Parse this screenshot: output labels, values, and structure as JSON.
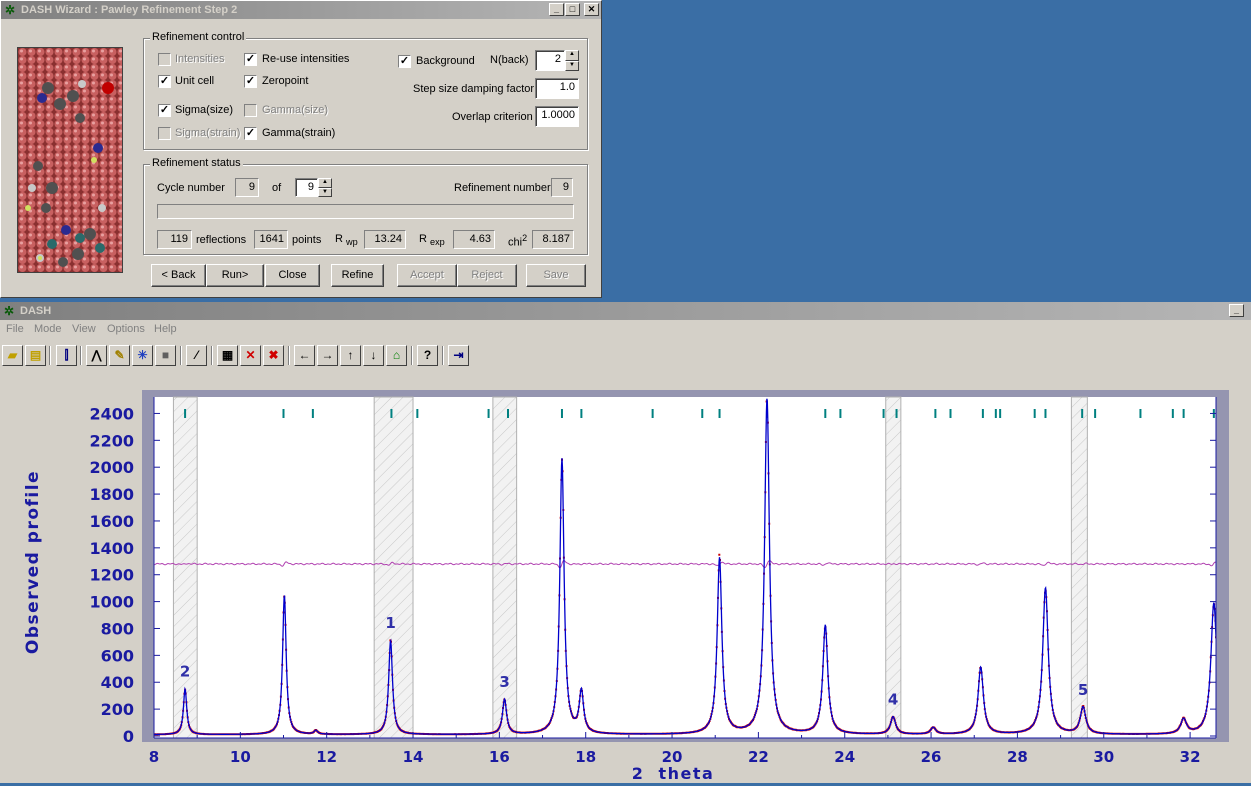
{
  "wizard": {
    "title": "DASH Wizard : Pawley Refinement Step 2",
    "refinement_control": {
      "legend": "Refinement control",
      "intensities": {
        "label": "Intensities",
        "checked": false,
        "enabled": false
      },
      "reuse_intensities": {
        "label": "Re-use intensities",
        "checked": true,
        "enabled": true
      },
      "unit_cell": {
        "label": "Unit cell",
        "checked": true,
        "enabled": true
      },
      "zeropoint": {
        "label": "Zeropoint",
        "checked": true,
        "enabled": true
      },
      "sigma_size": {
        "label": "Sigma(size)",
        "checked": true,
        "enabled": true
      },
      "gamma_size": {
        "label": "Gamma(size)",
        "checked": false,
        "enabled": false
      },
      "sigma_strain": {
        "label": "Sigma(strain)",
        "checked": false,
        "enabled": false
      },
      "gamma_strain": {
        "label": "Gamma(strain)",
        "checked": true,
        "enabled": true
      },
      "background": {
        "label": "Background",
        "checked": true
      },
      "nback_label": "N(back)",
      "nback_value": "2",
      "damping_label": "Step size damping factor",
      "damping_value": "1.0",
      "overlap_label": "Overlap criterion",
      "overlap_value": "1.0000"
    },
    "refinement_status": {
      "legend": "Refinement status",
      "cycle_label": "Cycle number",
      "cycle_value": "9",
      "of_label": "of",
      "of_value": "9",
      "refnum_label": "Refinement number",
      "refnum_value": "9",
      "reflections_value": "119",
      "reflections_label": "reflections",
      "points_value": "1641",
      "points_label": "points",
      "rwp_main": "R",
      "rwp_sub": "wp",
      "rwp_value": "13.24",
      "rexp_main": "R",
      "rexp_sub": "exp",
      "rexp_value": "4.63",
      "chi_main": "chi",
      "chi_sup": "2",
      "chi_value": "8.187"
    },
    "buttons": {
      "back": "< Back",
      "run": "Run>",
      "close": "Close",
      "refine": "Refine",
      "accept": "Accept",
      "reject": "Reject",
      "save": "Save"
    }
  },
  "main": {
    "title": "DASH",
    "menu": [
      "File",
      "Mode",
      "View",
      "Options",
      "Help"
    ],
    "toolbar_icons": [
      "open-folder-icon",
      "open-file-icon",
      "profile-view-icon",
      "peak-fit-icon",
      "pointer-tool-icon",
      "sun-tool-icon",
      "stop-icon",
      "wand-icon",
      "grid-icon",
      "delete-peaks-icon",
      "clear-peaks-icon",
      "arrow-left-icon",
      "arrow-right-icon",
      "arrow-up-icon",
      "arrow-down-icon",
      "home-icon",
      "help-icon",
      "exit-icon"
    ]
  },
  "chart_data": {
    "type": "line",
    "xlabel": "2  theta",
    "ylabel": "Observed  profile",
    "xlim": [
      8,
      32.6
    ],
    "ylim": [
      0,
      2500
    ],
    "xticks": [
      "8",
      "10",
      "12",
      "14",
      "16",
      "18",
      "20",
      "22",
      "24",
      "26",
      "28",
      "30",
      "32"
    ],
    "yticks": [
      "0",
      "200",
      "400",
      "600",
      "800",
      "1000",
      "1200",
      "1400",
      "1600",
      "1800",
      "2000",
      "2200",
      "2400"
    ],
    "colors": {
      "observed": "#cc0000",
      "calculated": "#0000cc",
      "difference": "#b040b0",
      "tickmarks": "#008080",
      "axis": "#1a1aa0"
    },
    "peaks": [
      {
        "x": 8.72,
        "h": 340
      },
      {
        "x": 11.02,
        "h": 1040
      },
      {
        "x": 11.75,
        "h": 28
      },
      {
        "x": 13.48,
        "h": 700
      },
      {
        "x": 16.12,
        "h": 260
      },
      {
        "x": 17.45,
        "h": 2050
      },
      {
        "x": 17.9,
        "h": 310
      },
      {
        "x": 21.1,
        "h": 1310
      },
      {
        "x": 22.2,
        "h": 2500
      },
      {
        "x": 23.55,
        "h": 810
      },
      {
        "x": 25.12,
        "h": 130
      },
      {
        "x": 26.05,
        "h": 50
      },
      {
        "x": 27.15,
        "h": 500
      },
      {
        "x": 28.65,
        "h": 1090
      },
      {
        "x": 29.52,
        "h": 200
      },
      {
        "x": 31.85,
        "h": 110
      },
      {
        "x": 32.55,
        "h": 980
      }
    ],
    "excluded_regions": [
      [
        8.45,
        9.0
      ],
      [
        13.1,
        14.0
      ],
      [
        15.85,
        16.4
      ],
      [
        24.95,
        25.3
      ],
      [
        29.25,
        29.62
      ]
    ],
    "region_labels": [
      {
        "text": "2",
        "x": 8.72
      },
      {
        "text": "1",
        "x": 13.48
      },
      {
        "text": "3",
        "x": 16.12
      },
      {
        "text": "4",
        "x": 25.12
      },
      {
        "text": "5",
        "x": 29.52
      }
    ],
    "tick_marks_x": [
      8.72,
      11.0,
      11.68,
      13.5,
      14.1,
      15.75,
      16.2,
      17.45,
      17.9,
      19.55,
      20.7,
      21.1,
      22.2,
      23.55,
      23.9,
      24.9,
      25.2,
      26.1,
      26.45,
      27.2,
      27.5,
      27.6,
      28.4,
      28.65,
      29.5,
      29.8,
      30.85,
      31.6,
      31.85,
      32.55
    ],
    "difference_baseline": 1280
  }
}
